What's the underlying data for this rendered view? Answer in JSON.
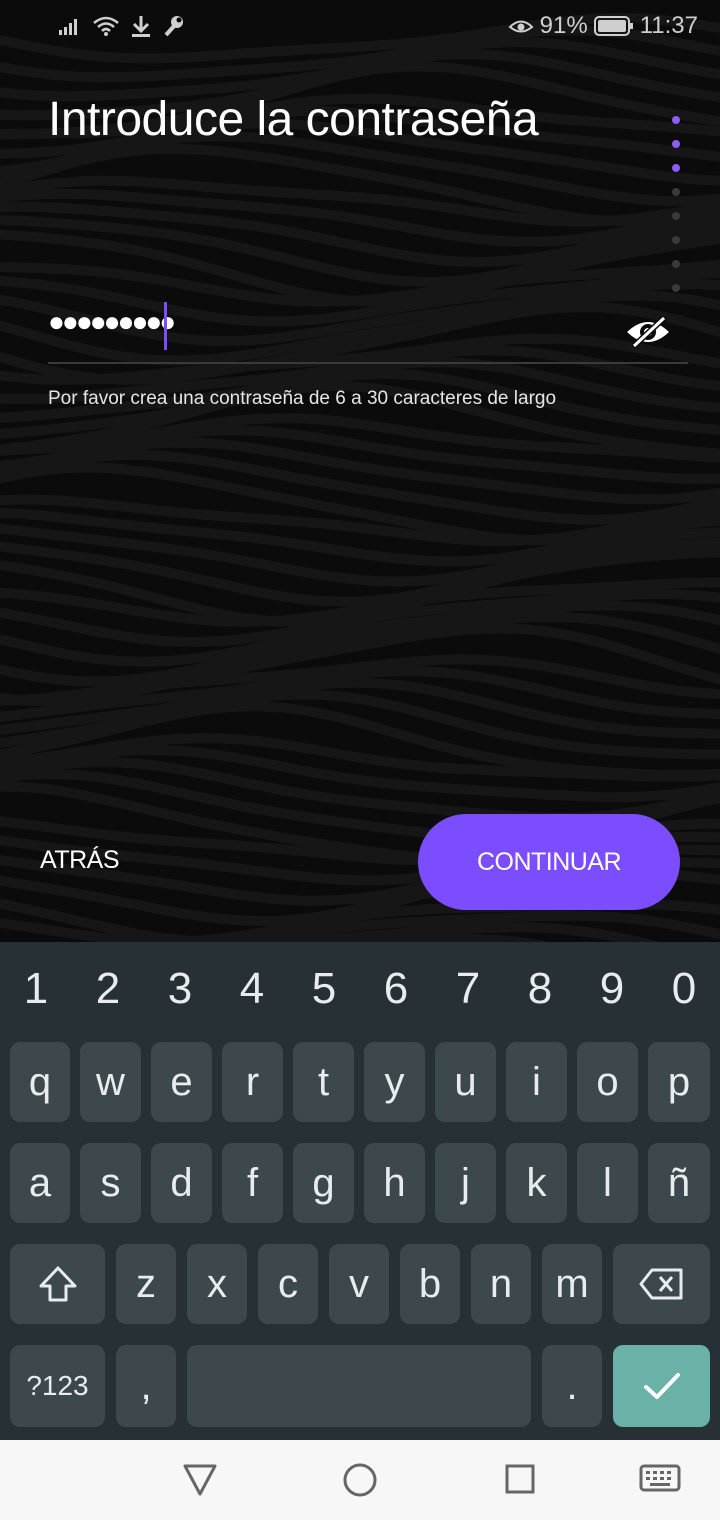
{
  "status_bar": {
    "battery_percent": "91%",
    "time": "11:37",
    "icons": [
      "signal-icon",
      "wifi-icon",
      "download-icon",
      "wrench-icon",
      "eye-comfort-icon",
      "battery-icon"
    ]
  },
  "screen": {
    "title": "Introduce la contraseña",
    "password_masked": "●●●●●●●●●",
    "hint": "Por favor crea una contraseña de 6 a 30 caracteres de largo",
    "progress": {
      "total_steps": 8,
      "current_step": 3
    },
    "back_label": "ATRÁS",
    "continue_label": "CONTINUAR",
    "accent_color": "#7c4dff"
  },
  "keyboard": {
    "numbers": [
      "1",
      "2",
      "3",
      "4",
      "5",
      "6",
      "7",
      "8",
      "9",
      "0"
    ],
    "row1": [
      "q",
      "w",
      "e",
      "r",
      "t",
      "y",
      "u",
      "i",
      "o",
      "p"
    ],
    "row2": [
      "a",
      "s",
      "d",
      "f",
      "g",
      "h",
      "j",
      "k",
      "l",
      "ñ"
    ],
    "row3": [
      "z",
      "x",
      "c",
      "v",
      "b",
      "n",
      "m"
    ],
    "symbols_label": "?123",
    "comma": ",",
    "period": "."
  }
}
